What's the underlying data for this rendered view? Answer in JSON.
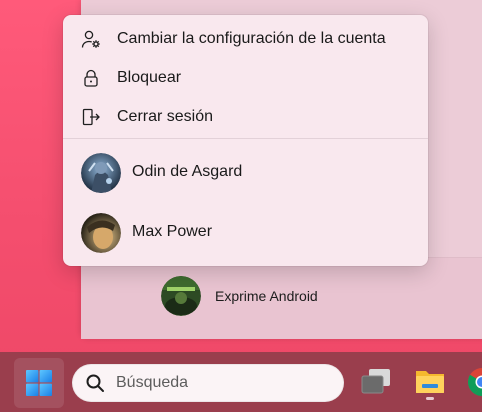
{
  "account_menu": {
    "items": [
      {
        "label": "Cambiar la configuración de la cuenta",
        "icon": "account-settings-icon"
      },
      {
        "label": "Bloquear",
        "icon": "lock-icon"
      },
      {
        "label": "Cerrar sesión",
        "icon": "sign-out-icon"
      }
    ],
    "users": [
      {
        "name": "Odin de Asgard",
        "avatar": "user-avatar-odin"
      },
      {
        "name": "Max Power",
        "avatar": "user-avatar-max"
      }
    ]
  },
  "start_menu": {
    "footer_user": {
      "name": "Exprime Android",
      "avatar": "user-avatar-exprime"
    }
  },
  "taskbar": {
    "search_placeholder": "Búsqueda",
    "icons": [
      "windows-start-icon",
      "search-icon",
      "task-view-icon",
      "file-explorer-icon",
      "chrome-icon"
    ]
  },
  "colors": {
    "wallpaper": "#f44e6e",
    "taskbar": "#9a3e4d",
    "menu_background": "#f9e8ee",
    "windows_blue": "#2f9bff"
  }
}
